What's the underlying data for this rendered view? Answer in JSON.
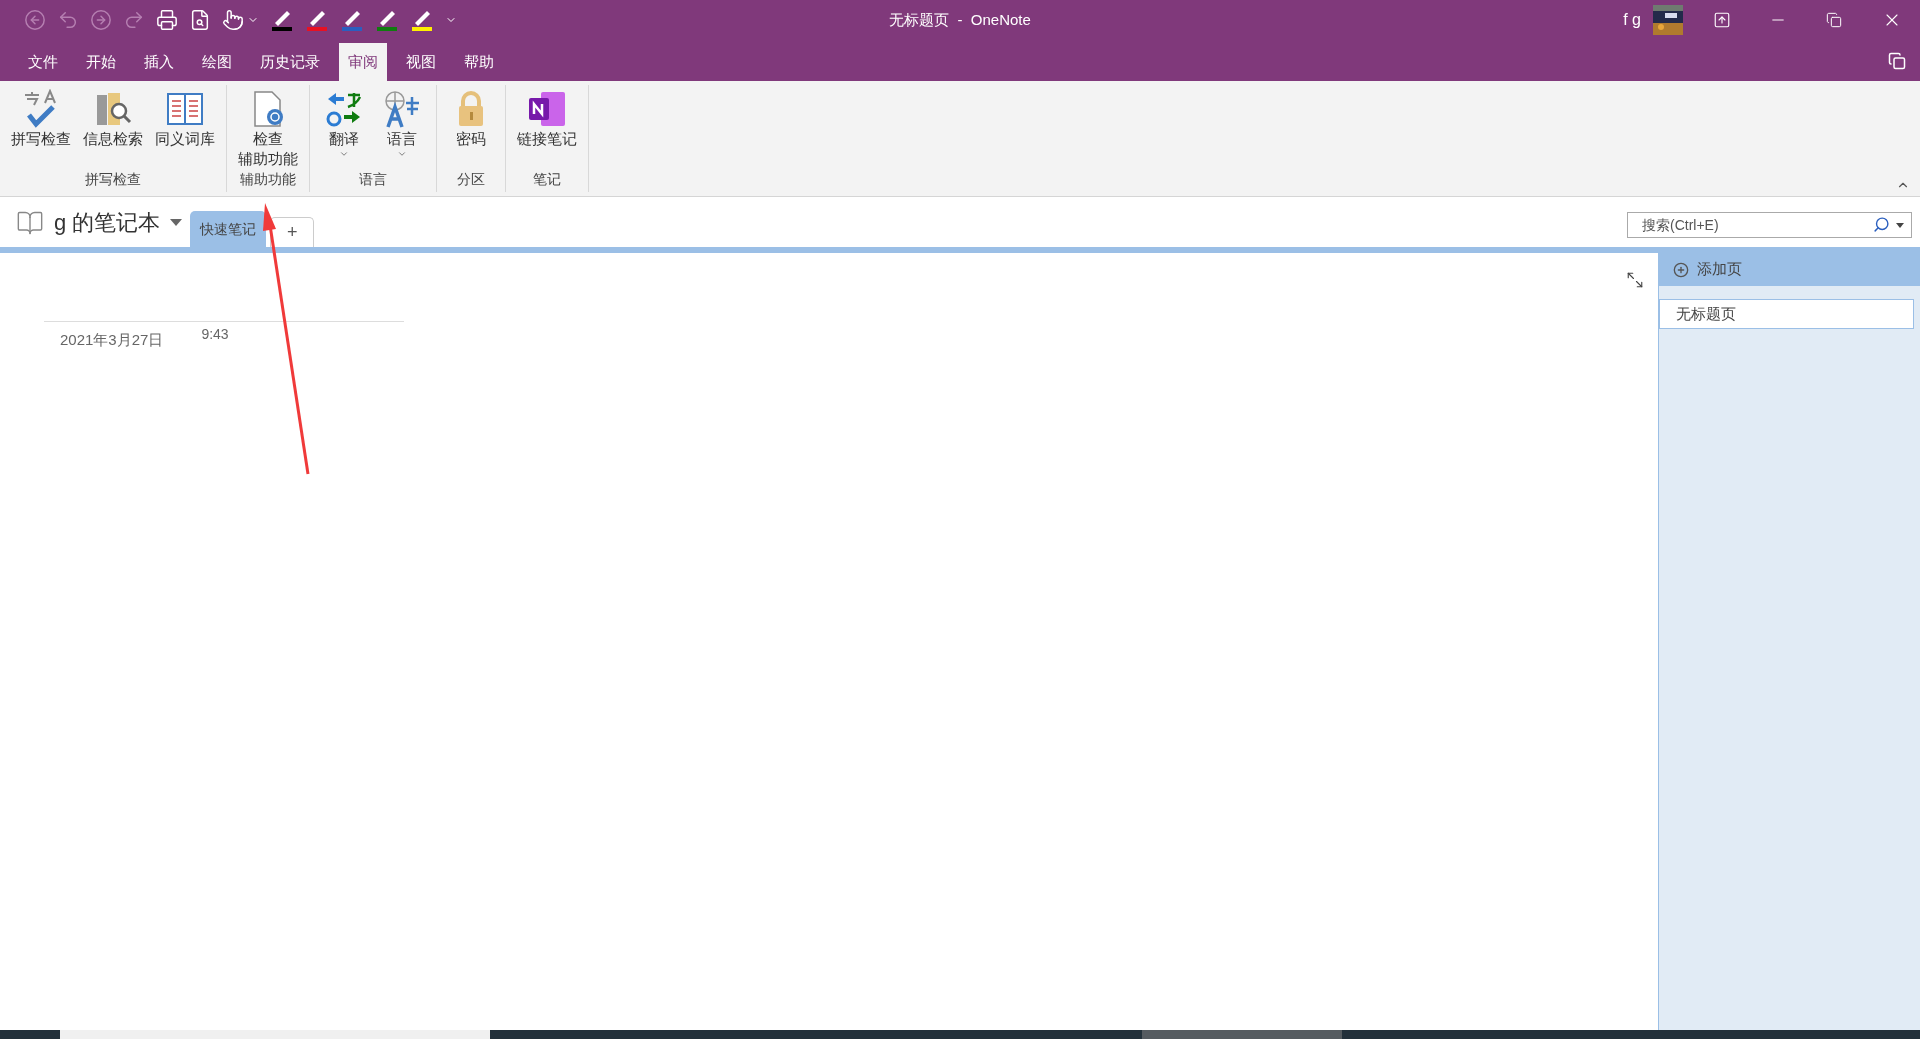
{
  "window": {
    "title": "无标题页  -  OneNote",
    "user": "f g"
  },
  "quick_access": [
    {
      "kind": "back",
      "disabled": true
    },
    {
      "kind": "undo",
      "disabled": true
    },
    {
      "kind": "forward",
      "disabled": true
    },
    {
      "kind": "redo",
      "disabled": true
    },
    {
      "kind": "print",
      "disabled": false
    },
    {
      "kind": "preview",
      "disabled": false
    },
    {
      "kind": "touch",
      "disabled": false
    }
  ],
  "pens": [
    {
      "color": "#000000"
    },
    {
      "color": "#e81123"
    },
    {
      "color": "#2b5fbf"
    },
    {
      "color": "#107c10"
    },
    {
      "color": "#fff100"
    }
  ],
  "menu_tabs": [
    {
      "label": "文件",
      "selected": false
    },
    {
      "label": "开始",
      "selected": false
    },
    {
      "label": "插入",
      "selected": false
    },
    {
      "label": "绘图",
      "selected": false
    },
    {
      "label": "历史记录",
      "selected": false
    },
    {
      "label": "审阅",
      "selected": true
    },
    {
      "label": "视图",
      "selected": false
    },
    {
      "label": "帮助",
      "selected": false
    }
  ],
  "ribbon": {
    "groups": [
      {
        "label": "拼写检查",
        "buttons": [
          {
            "kind": "spelling",
            "lines": [
              "拼写检查"
            ],
            "dropdown": false
          },
          {
            "kind": "research",
            "lines": [
              "信息检索"
            ],
            "dropdown": false
          },
          {
            "kind": "thesaurus",
            "lines": [
              "同义词库"
            ],
            "dropdown": false
          }
        ]
      },
      {
        "label": "辅助功能",
        "buttons": [
          {
            "kind": "accessibility",
            "lines": [
              "检查",
              "辅助功能"
            ],
            "dropdown": false
          }
        ]
      },
      {
        "label": "语言",
        "buttons": [
          {
            "kind": "translate",
            "lines": [
              "翻译"
            ],
            "dropdown": true
          },
          {
            "kind": "language",
            "lines": [
              "语言"
            ],
            "dropdown": true
          }
        ]
      },
      {
        "label": "分区",
        "buttons": [
          {
            "kind": "password",
            "lines": [
              "密码"
            ],
            "dropdown": false
          }
        ]
      },
      {
        "label": "笔记",
        "buttons": [
          {
            "kind": "linked_notes",
            "lines": [
              "链接笔记"
            ],
            "dropdown": false
          }
        ]
      }
    ]
  },
  "notebook": {
    "name": "g 的笔记本",
    "sections": [
      {
        "label": "快速笔记",
        "selected": true
      }
    ],
    "add_section": "+"
  },
  "search": {
    "placeholder": "搜索(Ctrl+E)"
  },
  "page": {
    "date": "2021年3月27日",
    "time": "9:43"
  },
  "page_panel": {
    "add_page": "添加页",
    "pages": [
      {
        "title": "无标题页",
        "selected": true
      }
    ]
  }
}
